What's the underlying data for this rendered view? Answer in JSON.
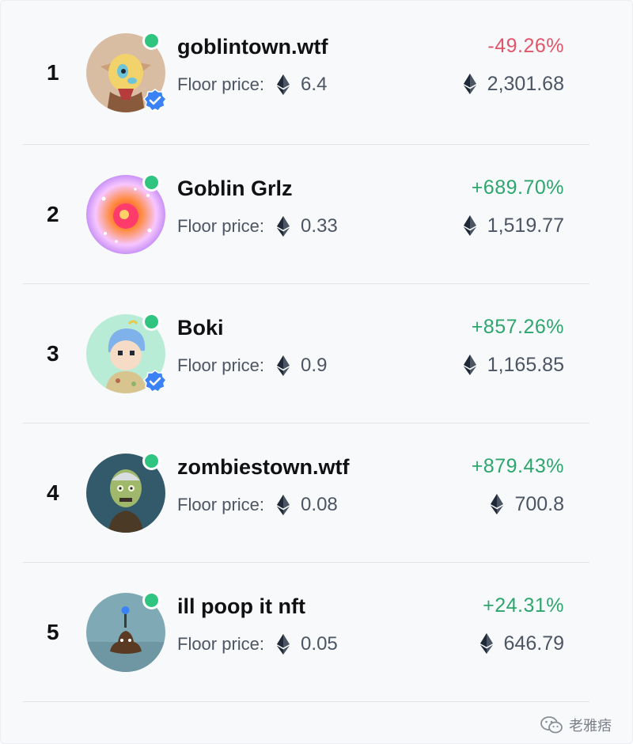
{
  "collections": [
    {
      "rank": "1",
      "name": "goblintown.wtf",
      "floor_label": "Floor price:",
      "floor_price": "6.4",
      "change": "-49.26%",
      "change_dir": "neg",
      "volume": "2,301.68",
      "verified": true,
      "online": true,
      "avatar_icon": "goblin-avatar"
    },
    {
      "rank": "2",
      "name": "Goblin Grlz",
      "floor_label": "Floor price:",
      "floor_price": "0.33",
      "change": "+689.70%",
      "change_dir": "pos",
      "volume": "1,519.77",
      "verified": false,
      "online": true,
      "avatar_icon": "goblin-grlz-avatar"
    },
    {
      "rank": "3",
      "name": "Boki",
      "floor_label": "Floor price:",
      "floor_price": "0.9",
      "change": "+857.26%",
      "change_dir": "pos",
      "volume": "1,165.85",
      "verified": true,
      "online": true,
      "avatar_icon": "boki-avatar"
    },
    {
      "rank": "4",
      "name": "zombiestown.wtf",
      "floor_label": "Floor price:",
      "floor_price": "0.08",
      "change": "+879.43%",
      "change_dir": "pos",
      "volume": "700.8",
      "verified": false,
      "online": true,
      "avatar_icon": "zombie-avatar"
    },
    {
      "rank": "5",
      "name": "ill poop it nft",
      "floor_label": "Floor price:",
      "floor_price": "0.05",
      "change": "+24.31%",
      "change_dir": "pos",
      "volume": "646.79",
      "verified": false,
      "online": true,
      "avatar_icon": "poop-avatar"
    }
  ],
  "currency_icon": "ethereum-icon",
  "watermark": {
    "text": "老雅痞",
    "icon": "wechat-icon"
  },
  "colors": {
    "positive": "#2da66d",
    "negative": "#e05569",
    "online": "#2fc580",
    "verified": "#3b82f6"
  }
}
